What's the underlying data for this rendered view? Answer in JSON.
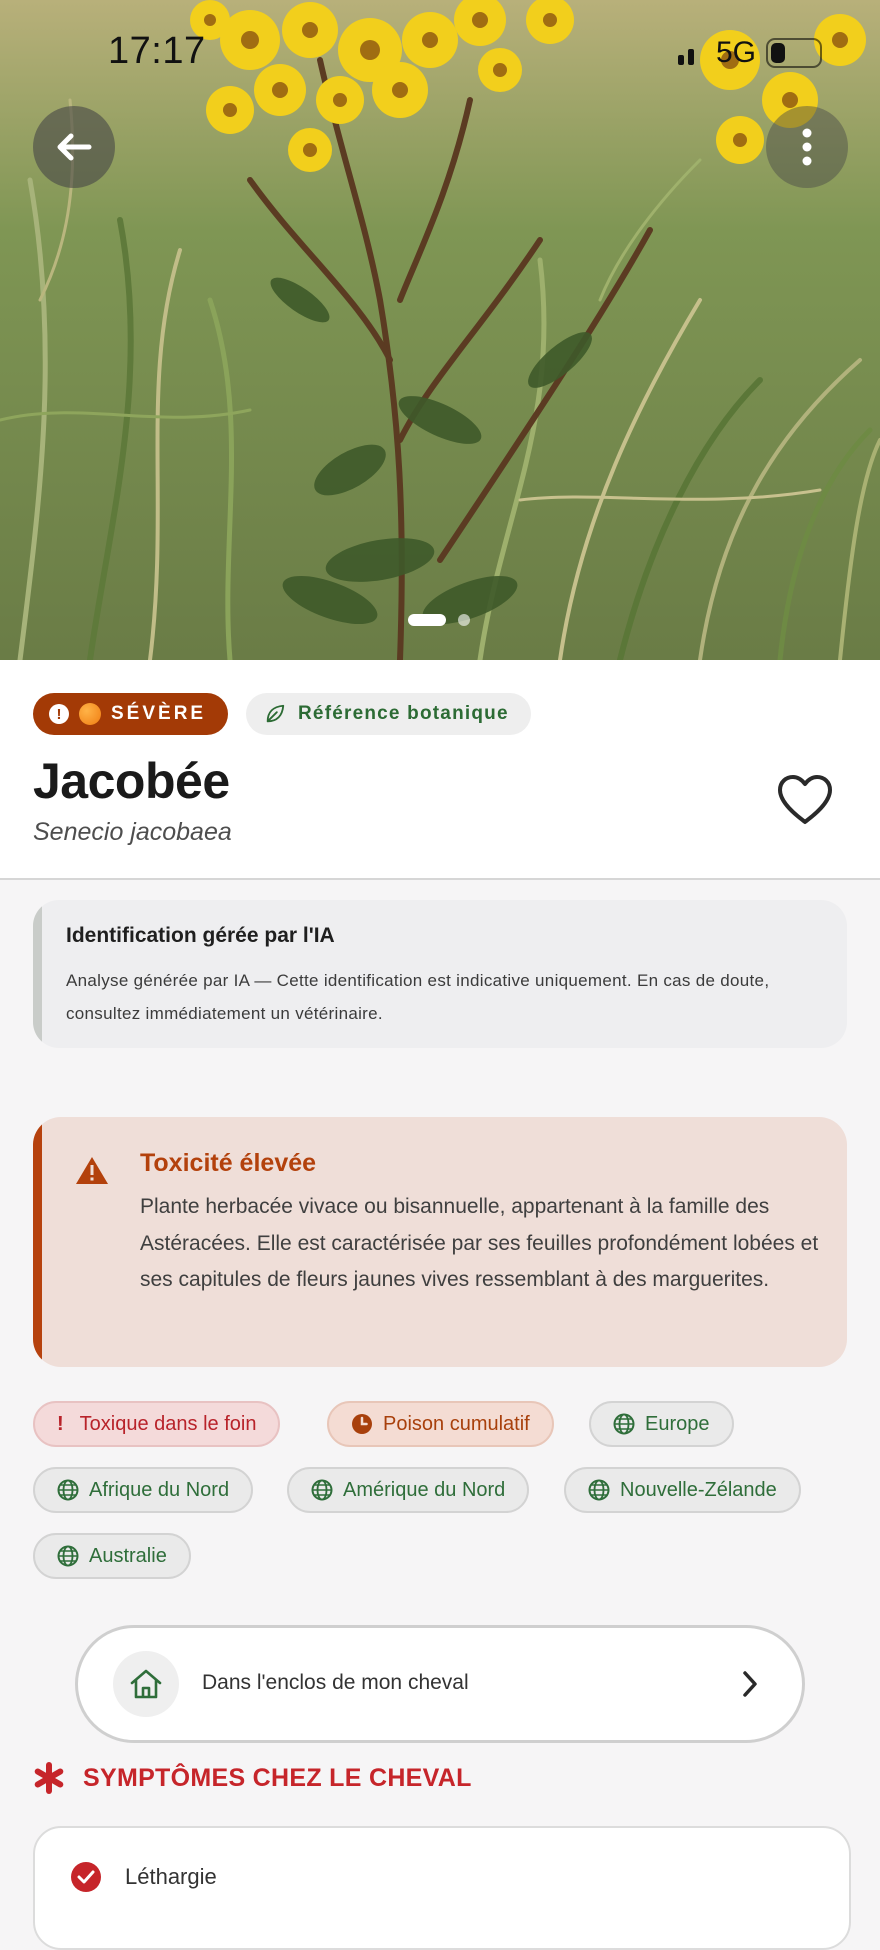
{
  "status_bar": {
    "time": "17:17",
    "network": "5G"
  },
  "hero": {
    "back_icon": "arrow-left-icon",
    "more_icon": "more-vertical-icon",
    "pages": 2,
    "current_page": 1
  },
  "plant": {
    "severity_label": "SÉVÈRE",
    "reference_label": "Référence botanique",
    "name": "Jacobée",
    "scientific_name": "Senecio jacobaea"
  },
  "ai_notice": {
    "title": "Identification gérée par l'IA",
    "text": "Analyse générée par IA — Cette identification est indicative uniquement. En cas de doute, consultez immédiatement un vétérinaire."
  },
  "toxicity": {
    "title": "Toxicité élevée",
    "description": "Plante herbacée vivace ou bisannuelle, appartenant à la famille des Astéracées. Elle est caractérisée par ses feuilles profondément lobées et ses capitules de fleurs jaunes vives ressemblant à des marguerites."
  },
  "tags": [
    {
      "label": "Toxique dans le foin",
      "icon": "exclamation-icon",
      "color": "#b8232a"
    },
    {
      "label": "Poison cumulatif",
      "icon": "clock-icon",
      "color": "#a8400c"
    },
    {
      "label": "Europe",
      "icon": "globe-icon",
      "color": "#2f6e3a"
    },
    {
      "label": "Afrique du Nord",
      "icon": "globe-icon",
      "color": "#2f6e3a"
    },
    {
      "label": "Amérique du Nord",
      "icon": "globe-icon",
      "color": "#2f6e3a"
    },
    {
      "label": "Nouvelle-Zélande",
      "icon": "globe-icon",
      "color": "#2f6e3a"
    },
    {
      "label": "Australie",
      "icon": "globe-icon",
      "color": "#2f6e3a"
    }
  ],
  "paddock_button": {
    "label": "Dans l'enclos de mon cheval"
  },
  "symptoms": {
    "title": "SYMPTÔMES CHEZ LE CHEVAL",
    "items": [
      {
        "label": "Léthargie"
      }
    ]
  },
  "colors": {
    "severe": "#a33a06",
    "danger": "#c6252a",
    "green": "#2f6e3a"
  }
}
